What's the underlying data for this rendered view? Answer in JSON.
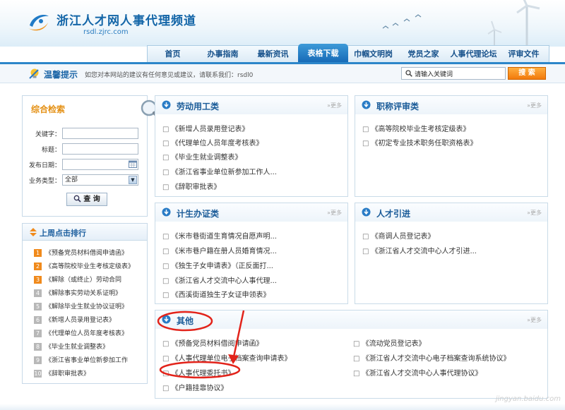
{
  "header": {
    "site_title": "浙江人才网人事代理频道",
    "site_url": "rsdl.zjrc.com"
  },
  "nav": {
    "items": [
      "首页",
      "办事指南",
      "最新资讯",
      "表格下载",
      "巾帼文明岗",
      "党员之家",
      "人事代理论坛",
      "评审文件"
    ],
    "active": "表格下载"
  },
  "tips": {
    "title": "温馨提示",
    "text": "如您对本网站的建议有任何意见或建议，请联系我们：rsdl0",
    "search_placeholder": "请输入关键词",
    "search_button": "搜 索"
  },
  "search_panel": {
    "title": "综合检索",
    "keyword_label": "关键字：",
    "title_label": "标题：",
    "date_label": "发布日期：",
    "type_label": "业务类型：",
    "type_value": "全部",
    "submit": "查 询"
  },
  "ranking": {
    "title": "上周点击排行",
    "items": [
      {
        "num": "1",
        "text": "《预备党员材料借阅申请函》"
      },
      {
        "num": "2",
        "text": "《高等院校毕业生考核定级表》"
      },
      {
        "num": "3",
        "text": "《解除（或终止）劳动合同"
      },
      {
        "num": "4",
        "text": "《解除事实劳动关系证明》"
      },
      {
        "num": "5",
        "text": "《解除毕业生就业协议证明》"
      },
      {
        "num": "6",
        "text": "《新增人员录用登记表》"
      },
      {
        "num": "7",
        "text": "《代理单位人员年度考核表》"
      },
      {
        "num": "8",
        "text": "《毕业生就业调整表》"
      },
      {
        "num": "9",
        "text": "《浙江省事业单位新参加工作"
      },
      {
        "num": "10",
        "text": "《辞职审批表》"
      }
    ]
  },
  "more_label": "更多",
  "categories": {
    "labor": {
      "title": "劳动用工类",
      "items": [
        "《新增人员录用登记表》",
        "《代理单位人员年度考核表》",
        "《毕业生就业调整表》",
        "《浙江省事业单位新参加工作人...",
        "《辞职审批表》"
      ]
    },
    "title_review": {
      "title": "职称评审类",
      "items": [
        "《高等院校毕业生考核定级表》",
        "《初定专业技术职务任职资格表》"
      ]
    },
    "family_planning": {
      "title": "计生办证类",
      "items": [
        "《米市巷街道生育情况自愿声明...",
        "《米市巷户籍在册人员婚育情况...",
        "《独生子女申请表》（正反面打...",
        "《浙江省人才交流中心人事代理...",
        "《西溪街道独生子女证申领表》"
      ]
    },
    "talent": {
      "title": "人才引进",
      "items": [
        "《商调人员登记表》",
        "《浙江省人才交流中心人才引进..."
      ]
    },
    "other": {
      "title": "其他",
      "left_items": [
        "《预备党员材料借阅申请函》",
        "《人事代理单位电子档案查询申请表》",
        "《人事代理委托书》",
        "《户籍挂靠协议》"
      ],
      "right_items": [
        "《流动党员登记表》",
        "《浙江省人才交流中心电子档案查询系统协议》",
        "《浙江省人才交流中心人事代理协议》"
      ]
    }
  },
  "watermark": "jingyan.baidu.com",
  "colors": {
    "brand_blue": "#1a5b98",
    "nav_active": "#1669b6",
    "accent_orange": "#f27a0c",
    "annotation_red": "#e2231a"
  }
}
